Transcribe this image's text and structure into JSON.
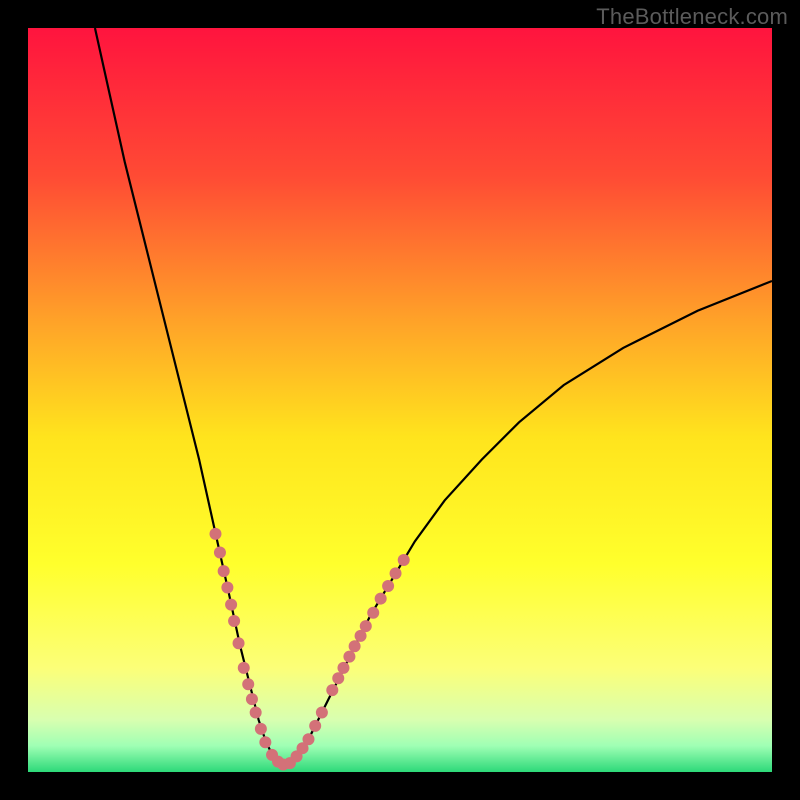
{
  "watermark": "TheBottleneck.com",
  "chart_data": {
    "type": "line",
    "title": "",
    "xlabel": "",
    "ylabel": "",
    "xlim": [
      0,
      100
    ],
    "ylim": [
      0,
      100
    ],
    "grid": false,
    "background_gradient": {
      "stops": [
        {
          "offset": 0.0,
          "color": "#ff143e"
        },
        {
          "offset": 0.2,
          "color": "#ff4b34"
        },
        {
          "offset": 0.4,
          "color": "#ffa528"
        },
        {
          "offset": 0.55,
          "color": "#ffe41d"
        },
        {
          "offset": 0.72,
          "color": "#ffff2c"
        },
        {
          "offset": 0.86,
          "color": "#fcff78"
        },
        {
          "offset": 0.93,
          "color": "#d8ffb0"
        },
        {
          "offset": 0.965,
          "color": "#9fffb4"
        },
        {
          "offset": 1.0,
          "color": "#2dd979"
        }
      ]
    },
    "series": [
      {
        "name": "bottleneck-curve",
        "x": [
          9.0,
          11.0,
          13.0,
          15.0,
          17.0,
          19.0,
          21.0,
          23.0,
          25.0,
          27.0,
          28.5,
          30.0,
          31.0,
          32.0,
          33.0,
          34.0,
          35.0,
          36.5,
          38.0,
          40.0,
          42.0,
          44.0,
          46.0,
          49.0,
          52.0,
          56.0,
          61.0,
          66.0,
          72.0,
          80.0,
          90.0,
          100.0
        ],
        "y": [
          100.0,
          91.0,
          82.0,
          74.0,
          66.0,
          58.0,
          50.0,
          42.0,
          33.0,
          24.0,
          17.0,
          11.0,
          7.0,
          4.0,
          2.0,
          1.0,
          1.2,
          2.5,
          5.0,
          9.0,
          13.0,
          17.0,
          21.0,
          26.0,
          31.0,
          36.5,
          42.0,
          47.0,
          52.0,
          57.0,
          62.0,
          66.0
        ],
        "color": "#000000",
        "width": 2.2
      }
    ],
    "markers": {
      "name": "data-points",
      "color": "#d37178",
      "radius": 6,
      "points_xy": [
        [
          25.2,
          32.0
        ],
        [
          25.8,
          29.5
        ],
        [
          26.3,
          27.0
        ],
        [
          26.8,
          24.8
        ],
        [
          27.3,
          22.5
        ],
        [
          27.7,
          20.3
        ],
        [
          28.3,
          17.3
        ],
        [
          29.0,
          14.0
        ],
        [
          29.6,
          11.8
        ],
        [
          30.1,
          9.8
        ],
        [
          30.6,
          8.0
        ],
        [
          31.3,
          5.8
        ],
        [
          31.9,
          4.0
        ],
        [
          32.8,
          2.3
        ],
        [
          33.6,
          1.4
        ],
        [
          34.3,
          1.0
        ],
        [
          35.2,
          1.2
        ],
        [
          36.1,
          2.1
        ],
        [
          36.9,
          3.2
        ],
        [
          37.7,
          4.4
        ],
        [
          38.6,
          6.2
        ],
        [
          39.5,
          8.0
        ],
        [
          40.9,
          11.0
        ],
        [
          41.7,
          12.6
        ],
        [
          42.4,
          14.0
        ],
        [
          43.2,
          15.5
        ],
        [
          43.9,
          16.9
        ],
        [
          44.7,
          18.3
        ],
        [
          45.4,
          19.6
        ],
        [
          46.4,
          21.4
        ],
        [
          47.4,
          23.3
        ],
        [
          48.4,
          25.0
        ],
        [
          49.4,
          26.7
        ],
        [
          50.5,
          28.5
        ]
      ]
    }
  }
}
